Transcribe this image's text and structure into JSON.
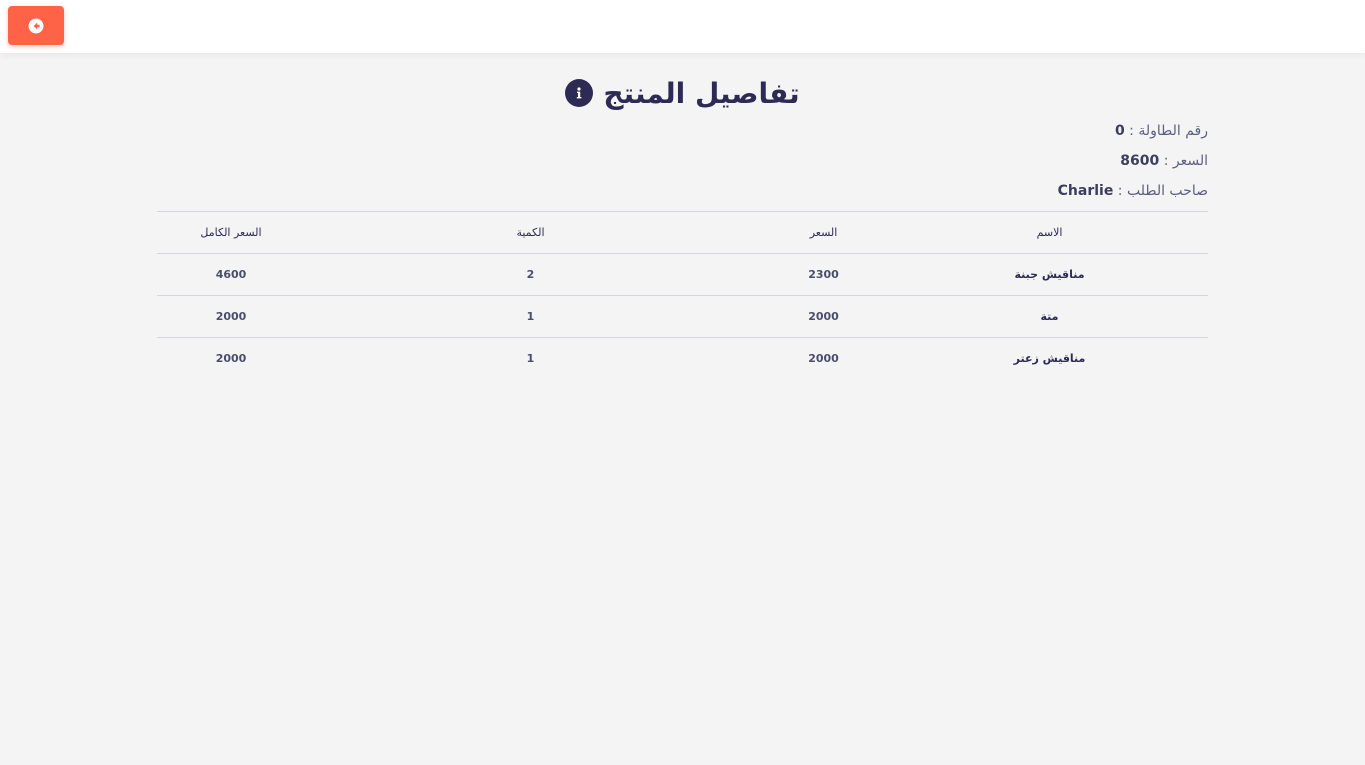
{
  "header": {
    "back_icon": "arrow-left-circle-icon",
    "accent_color": "#ff6347"
  },
  "page": {
    "title": "تفاصيل المنتج",
    "title_icon": "info-circle-icon"
  },
  "details": {
    "table_number_label": "رقم الطاولة :",
    "table_number_value": "0",
    "price_label": "السعر :",
    "price_value": "8600",
    "owner_label": "صاحب الطلب :",
    "owner_value": "Charlie"
  },
  "table": {
    "headers": {
      "name": "الاسم",
      "price": "السعر",
      "quantity": "الكمية",
      "total": "السعر الكامل"
    },
    "rows": [
      {
        "name": "مناقيش جبنة",
        "price": "2300",
        "quantity": "2",
        "total": "4600"
      },
      {
        "name": "متة",
        "price": "2000",
        "quantity": "1",
        "total": "2000"
      },
      {
        "name": "مناقيش زعتر",
        "price": "2000",
        "quantity": "1",
        "total": "2000"
      }
    ]
  }
}
